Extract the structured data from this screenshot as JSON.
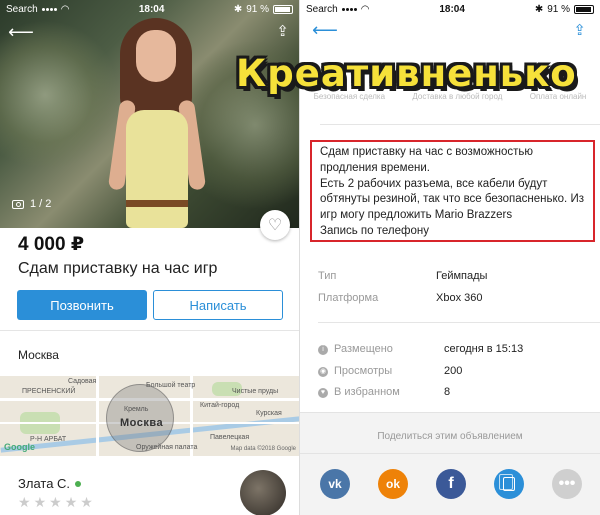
{
  "left_screen": {
    "status": {
      "carrier": "Search",
      "time": "18:04",
      "battery": "91 %"
    },
    "photo": {
      "counter": "1 / 2"
    },
    "listing": {
      "price": "4 000 ₽",
      "title": "Сдам приставку на час игр",
      "call_label": "Позвонить",
      "write_label": "Написать",
      "city": "Москва"
    },
    "map": {
      "labels": [
        "Большой театр",
        "Кремль",
        "Москва",
        "ПРЕСНЕНСКИЙ",
        "Р-Н АРБАТ",
        "Оружейная палата",
        "Китай-город",
        "Чистые пруды",
        "Садовая",
        "Курская",
        "Павелецкая"
      ],
      "google": "Google",
      "copyright": "Map data ©2018 Google"
    },
    "seller": {
      "name": "Злата С.",
      "rating": 0
    }
  },
  "right_screen": {
    "status": {
      "carrier": "Search",
      "time": "18:04",
      "battery": "91 %"
    },
    "safe_deal": [
      "Безопасная сделка",
      "Доставка в любой город",
      "Оплата онлайн"
    ],
    "banner": "Креативненько",
    "description": [
      "Сдам приставку на час с возможностью",
      "продления времени.",
      "Есть 2 рабочих разъема, все кабели будут",
      "обтянуты резиной, так что все безопасненько. Из",
      "игр могу предложить Mario Brazzers",
      "Запись по телефону"
    ],
    "properties": [
      {
        "label": "Тип",
        "value": "Геймпады"
      },
      {
        "label": "Платформа",
        "value": "Xbox 360"
      }
    ],
    "stats": [
      {
        "icon": "info-icon",
        "label": "Размещено",
        "value": "сегодня в 15:13"
      },
      {
        "icon": "eye-icon",
        "label": "Просмотры",
        "value": "200"
      },
      {
        "icon": "heart-icon",
        "label": "В избранном",
        "value": "8"
      }
    ],
    "share": {
      "title": "Поделиться этим объявлением",
      "networks": [
        "vk",
        "ok",
        "facebook",
        "copy-link",
        "more"
      ]
    }
  },
  "colors": {
    "accent": "#2b8fd8",
    "highlight_border": "#d8252b",
    "banner_fill": "#f6e13a",
    "online": "#4caf50"
  }
}
